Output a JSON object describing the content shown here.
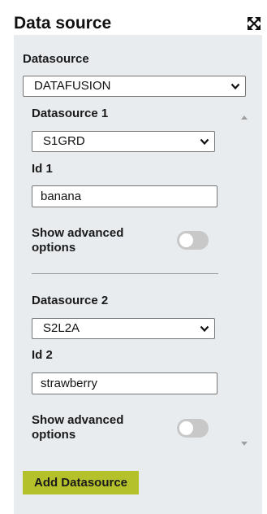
{
  "header": {
    "title": "Data source",
    "expand_icon": "expand-arrows-icon"
  },
  "datasource": {
    "label": "Datasource",
    "selected": "DATAFUSION"
  },
  "sources": [
    {
      "heading": "Datasource 1",
      "selected": "S1GRD",
      "id_label": "Id 1",
      "id_value": "banana",
      "advanced_label": "Show advanced options",
      "advanced_enabled": false
    },
    {
      "heading": "Datasource 2",
      "selected": "S2L2A",
      "id_label": "Id 2",
      "id_value": "strawberry",
      "advanced_label": "Show advanced options",
      "advanced_enabled": false
    }
  ],
  "add_button": {
    "label": "Add Datasource",
    "color": "#b5c12a"
  }
}
